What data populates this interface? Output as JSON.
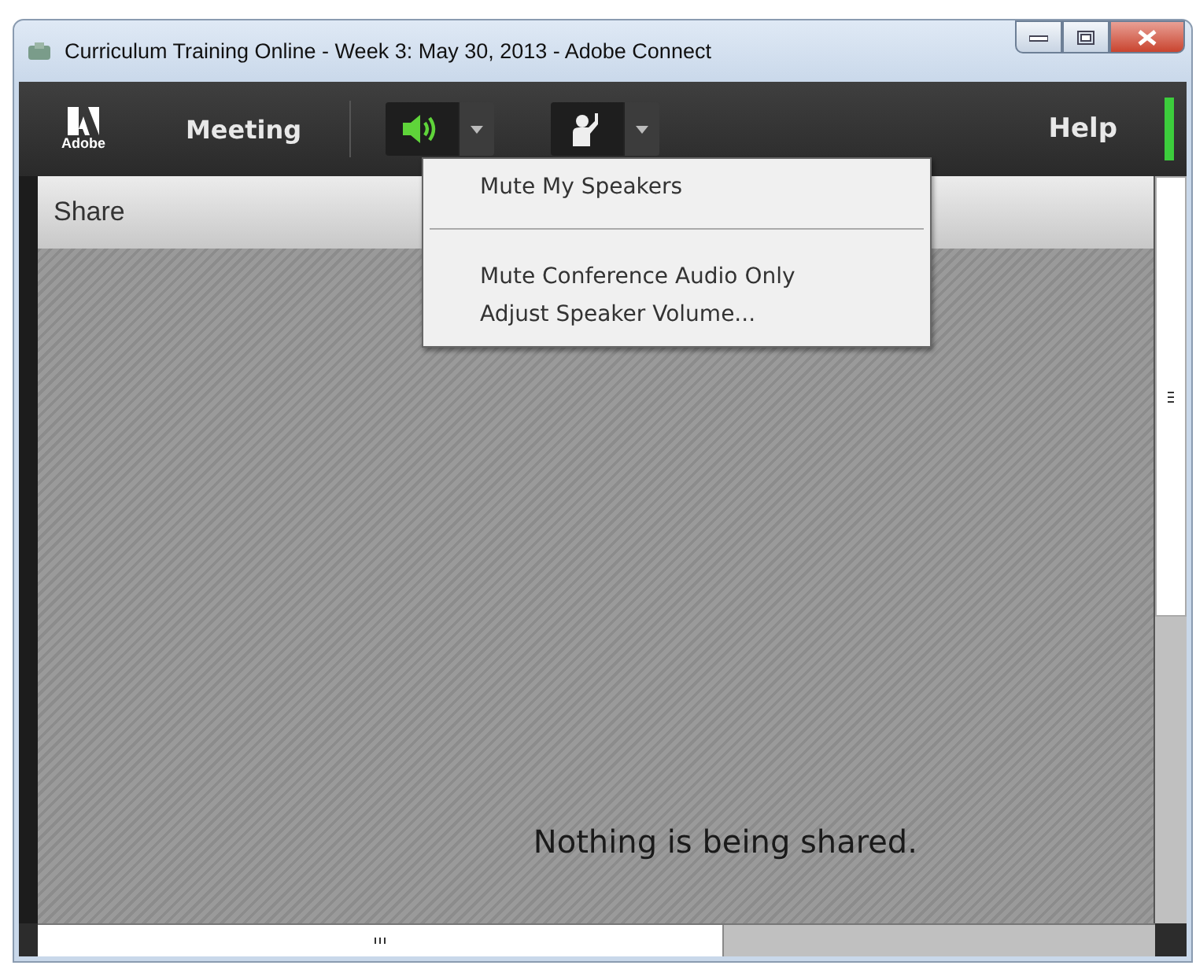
{
  "window": {
    "title": "Curriculum Training Online - Week 3: May 30, 2013 - Adobe Connect"
  },
  "toolbar": {
    "logo": "Adobe",
    "menu": "Meeting",
    "speaker_active": true,
    "help": "Help"
  },
  "audio_menu": {
    "sections": [
      {
        "items": [
          "Mute My Speakers"
        ]
      },
      {
        "items": [
          "Mute Conference Audio Only",
          "Adjust Speaker Volume..."
        ]
      }
    ]
  },
  "share_pod": {
    "title": "Share",
    "message": "Nothing is being shared."
  }
}
